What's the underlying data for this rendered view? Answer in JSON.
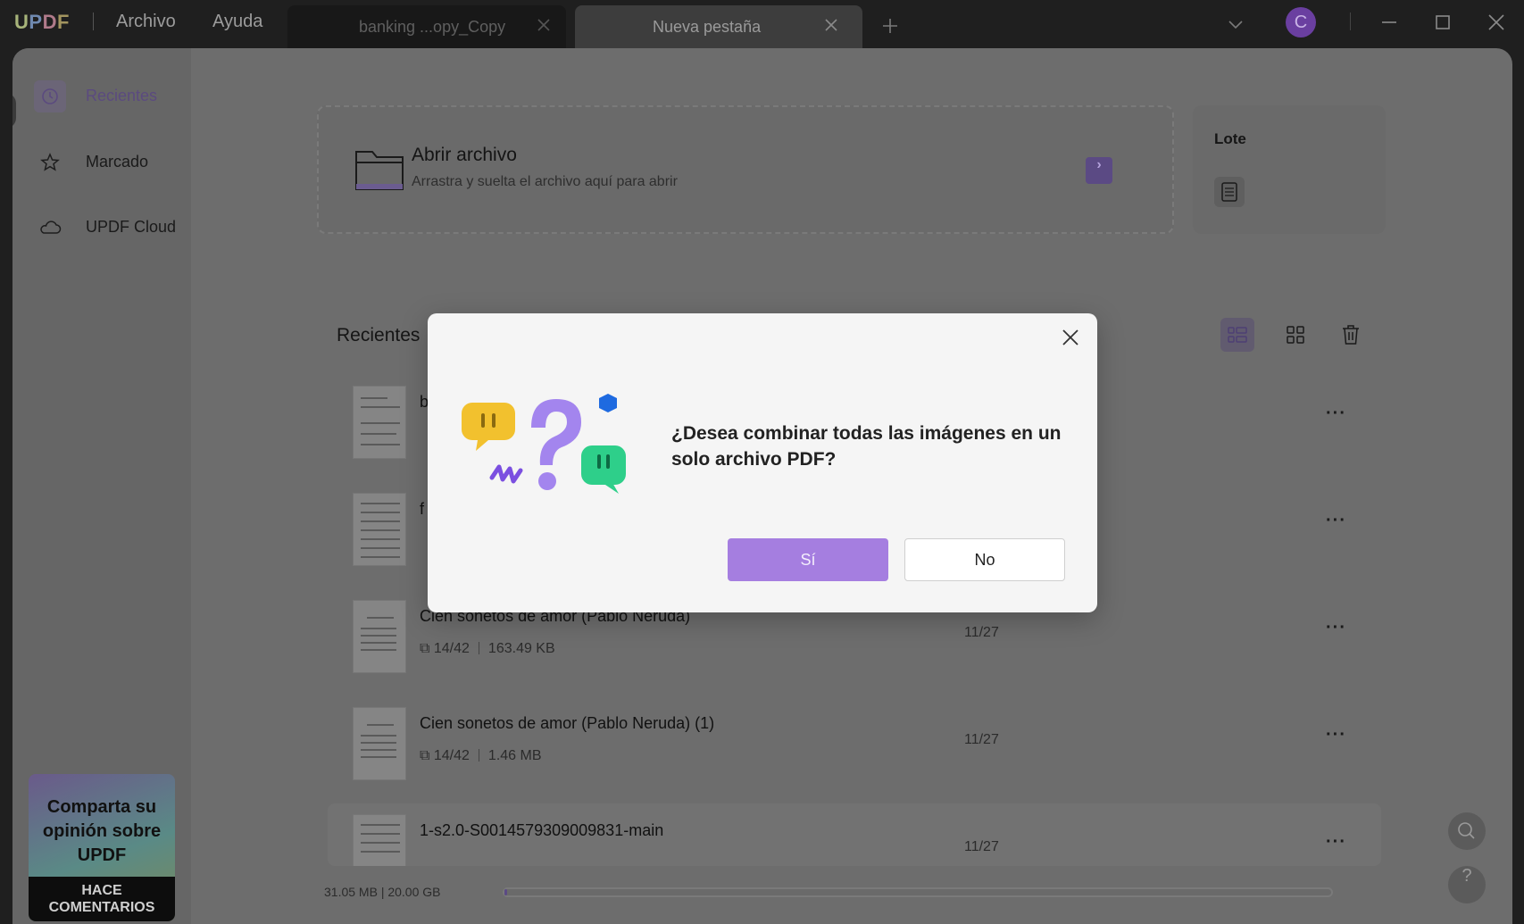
{
  "app": {
    "logo": "UPDF",
    "menu": [
      "Archivo",
      "Ayuda"
    ],
    "tabs": [
      {
        "label": "banking ...opy_Copy"
      },
      {
        "label": "Nueva pestaña"
      }
    ],
    "avatar_initial": "C"
  },
  "sidebar": {
    "items": [
      {
        "label": "Recientes",
        "icon": "clock-icon"
      },
      {
        "label": "Marcado",
        "icon": "star-icon"
      },
      {
        "label": "UPDF Cloud",
        "icon": "cloud-icon"
      }
    ],
    "promo": {
      "text": "Comparta su opinión sobre UPDF",
      "button": "HACE COMENTARIOS"
    }
  },
  "open_file": {
    "title": "Abrir archivo",
    "subtitle": "Arrastra y suelta el archivo aquí para abrir",
    "arrow": "›"
  },
  "batch": {
    "title": "Lote"
  },
  "recent": {
    "title": "Recientes",
    "files": [
      {
        "name": "b",
        "pages": "",
        "size": "",
        "date": ""
      },
      {
        "name": "f",
        "pages": "",
        "size": "",
        "date": ""
      },
      {
        "name": "Cien sonetos de amor (Pablo Neruda)",
        "pages": "14/42",
        "size": "163.49 KB",
        "date": "11/27"
      },
      {
        "name": "Cien sonetos de amor (Pablo Neruda) (1)",
        "pages": "14/42",
        "size": "1.46 MB",
        "date": "11/27"
      },
      {
        "name": "1-s2.0-S0014579309009831-main",
        "pages": "",
        "size": "",
        "date": "11/27"
      }
    ],
    "more": "···"
  },
  "storage": {
    "text": "31.05 MB | 20.00 GB",
    "used_fraction": 0.0015
  },
  "dialog": {
    "message": "¿Desea combinar todas las imágenes en un solo archivo PDF?",
    "yes": "Sí",
    "no": "No"
  },
  "float": {
    "help": "?"
  },
  "colors": {
    "accent": "#a57ee0",
    "overlay": "#6d6d6d"
  }
}
